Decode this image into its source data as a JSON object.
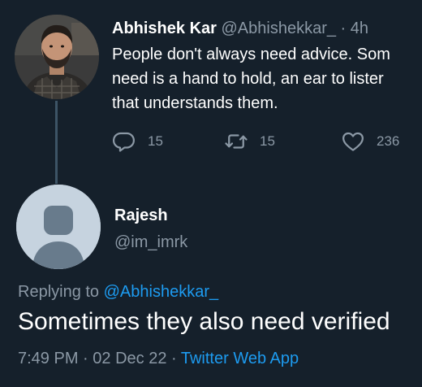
{
  "colors": {
    "background": "#15202b",
    "text_primary": "#ffffff",
    "text_secondary": "#8b98a5",
    "accent": "#1d9bf0",
    "thread_line": "#3d5466",
    "default_avatar_bg": "#c6d3df"
  },
  "parent_tweet": {
    "author_name": "Abhishek Kar",
    "author_handle": "@Abhishekkar_",
    "separator": "·",
    "time": "4h",
    "text_lines": [
      "People don't always need advice. Som",
      "need is a hand to hold, an ear to lister",
      "that understands them."
    ],
    "actions": {
      "reply_icon": "reply-icon",
      "reply_count": "15",
      "retweet_icon": "retweet-icon",
      "retweet_count": "15",
      "like_icon": "heart-icon",
      "like_count": "236"
    }
  },
  "reply_tweet": {
    "author_name": "Rajesh",
    "author_handle": "@im_imrk",
    "replying_to_label": "Replying to ",
    "replying_to_handle": "@Abhishekkar_",
    "text": "Sometimes they also need verified",
    "time": "7:49 PM",
    "separator": " · ",
    "date": "02 Dec 22",
    "separator2": " · ",
    "source": "Twitter Web App"
  }
}
